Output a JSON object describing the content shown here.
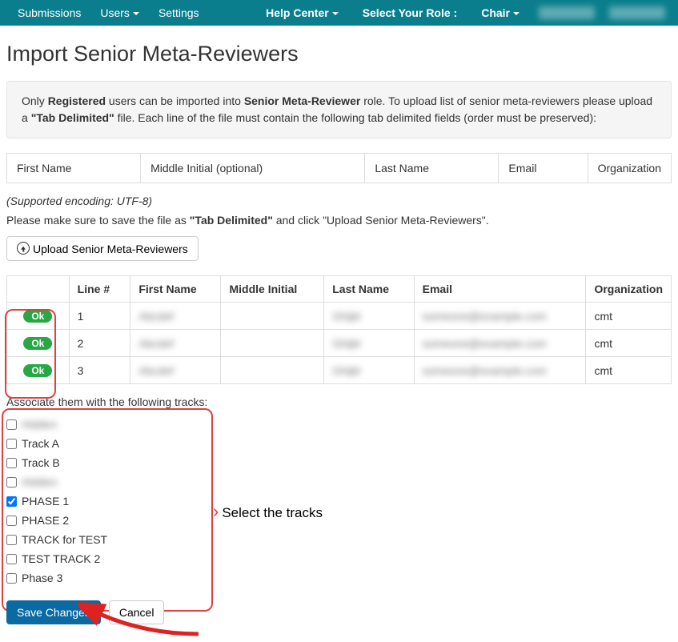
{
  "nav": {
    "submissions": "Submissions",
    "users": "Users",
    "settings": "Settings",
    "help": "Help Center",
    "role_label": "Select Your Role :",
    "role_value": "Chair"
  },
  "page": {
    "title": "Import Senior Meta-Reviewers"
  },
  "info": {
    "pre1": "Only ",
    "b1": "Registered",
    "mid1": " users can be imported into ",
    "b2": "Senior Meta-Reviewer",
    "mid2": " role. To upload list of senior meta-reviewers please upload a ",
    "b3": "\"Tab Delimited\"",
    "post": " file. Each line of the file must contain the following tab delimited fields (order must be preserved):"
  },
  "field_headers": {
    "first": "First Name",
    "middle": "Middle Initial (optional)",
    "last": "Last Name",
    "email": "Email",
    "org": "Organization"
  },
  "encoding_note": "(Supported encoding: UTF-8)",
  "save_note_pre": "Please make sure to save the file as ",
  "save_note_b": "\"Tab Delimited\"",
  "save_note_post": " and click \"Upload Senior Meta-Reviewers\".",
  "upload_btn": "Upload Senior Meta-Reviewers",
  "grid": {
    "headers": {
      "status": "",
      "line": "Line #",
      "first": "First Name",
      "mi": "Middle Initial",
      "last": "Last Name",
      "email": "Email",
      "org": "Organization"
    },
    "rows": [
      {
        "status": "Ok",
        "line": "1",
        "first": "—",
        "mi": "",
        "last": "—",
        "email": "—",
        "org": "cmt"
      },
      {
        "status": "Ok",
        "line": "2",
        "first": "—",
        "mi": "",
        "last": "—",
        "email": "—",
        "org": "cmt"
      },
      {
        "status": "Ok",
        "line": "3",
        "first": "—",
        "mi": "",
        "last": "—",
        "email": "—",
        "org": "cmt"
      }
    ]
  },
  "tracks": {
    "label": "Associate them with the following tracks:",
    "items": [
      {
        "label": "——",
        "checked": false,
        "blur": true
      },
      {
        "label": "Track A",
        "checked": false
      },
      {
        "label": "Track B",
        "checked": false
      },
      {
        "label": "——",
        "checked": false,
        "blur": true
      },
      {
        "label": "PHASE 1",
        "checked": true
      },
      {
        "label": "PHASE 2",
        "checked": false
      },
      {
        "label": "TRACK for TEST",
        "checked": false
      },
      {
        "label": "TEST TRACK 2",
        "checked": false
      },
      {
        "label": "Phase 3",
        "checked": false
      }
    ],
    "annotation": "Select the tracks"
  },
  "actions": {
    "save": "Save Changes",
    "cancel": "Cancel"
  }
}
